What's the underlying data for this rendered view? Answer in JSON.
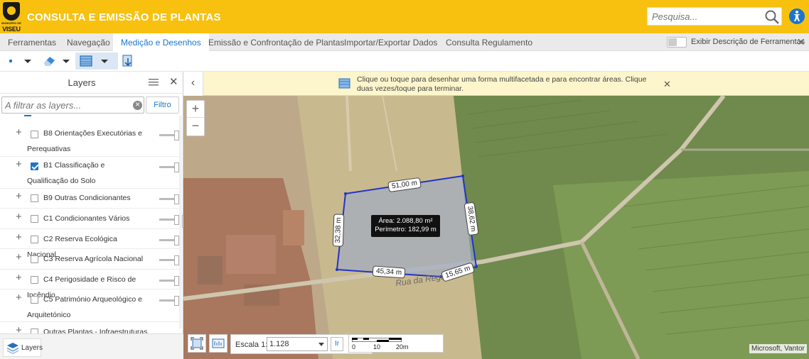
{
  "header": {
    "logo_subtitle": "MUNICÍPIO DE",
    "logo_city": "VISEU",
    "title": "CONSULTA E EMISSÃO DE PLANTAS",
    "search_placeholder": "Pesquisa...",
    "accent_color": "#f8c10f"
  },
  "menu": {
    "tabs": [
      "Ferramentas",
      "Navegação",
      "Medição e Desenhos",
      "Emissão e Confrontação de Plantas",
      "Importar/Exportar Dados",
      "Consulta Regulamento"
    ],
    "active_tab": "Medição e Desenhos",
    "toggle_label": "Exibir Descrição de Ferramentas",
    "toggle_on": false
  },
  "layers_panel": {
    "title": "Layers",
    "filter_placeholder": "A filtrar as layers...",
    "filter_button": "Filtro",
    "items": [
      {
        "label": "B8 Orientações Executórias e Perequativas",
        "checked": false
      },
      {
        "label": "B1 Classificação e Qualificação do Solo",
        "checked": true
      },
      {
        "label": "B9 Outras Condicionantes",
        "checked": false
      },
      {
        "label": "C1 Condicionantes Vários",
        "checked": false
      },
      {
        "label": "C2 Reserva Ecológica Nacional",
        "checked": false
      },
      {
        "label": "C3 Reserva Agrícola Nacional",
        "checked": false
      },
      {
        "label": "C4 Perigosidade e Risco de Incêndio",
        "checked": false
      },
      {
        "label": "C5 Património Arqueológico e Arquitetónico",
        "checked": false
      },
      {
        "label": "Outras Plantas - Infraestruturas",
        "checked": false
      }
    ],
    "footer_button": "Layers"
  },
  "map": {
    "banner_text": "Clique ou toque para desenhar uma forma multifacetada e para encontrar áreas. Clique duas vezes/toque para terminar.",
    "measurements": {
      "top": "51,00 m",
      "right": "38,62 m",
      "bottom_left": "45,34 m",
      "bottom_right": "15,65 m",
      "left": "32,38 m"
    },
    "area_text": "Área: 2.088,80 m²",
    "perimeter_text": "Perímetro: 182,99 m",
    "street_name": "Rua da Regueira",
    "scale_label": "Escala 1:",
    "scale_value": "1.128",
    "go_button": "Ir",
    "scale_ticks": [
      "0",
      "10",
      "20m"
    ],
    "attribution": "Microsoft, Vantor",
    "polygon_color": "#2433c8"
  }
}
